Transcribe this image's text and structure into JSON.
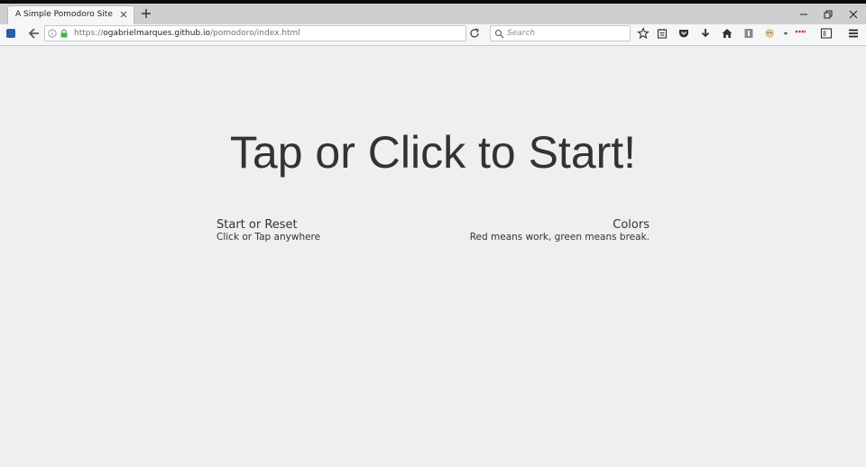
{
  "browser": {
    "tab": {
      "title": "A Simple Pomodoro Site"
    },
    "url": {
      "scheme": "https://",
      "host": "ogabrielmarques.github.io",
      "path": "/pomodoro/index.html"
    },
    "search": {
      "placeholder": "Search"
    },
    "toolbar_icons": [
      "star-icon",
      "reading-list-icon",
      "pocket-icon",
      "download-icon",
      "home-icon",
      "library-icon",
      "extension-icon",
      "overflow-icon",
      "extension-red-icon",
      "sidebar-icon",
      "menu-icon"
    ]
  },
  "page": {
    "heading": "Tap or Click to Start!",
    "left_block": {
      "title": "Start or Reset",
      "subtitle": "Click or Tap anywhere"
    },
    "right_block": {
      "title": "Colors",
      "subtitle": "Red means work, green means break."
    }
  }
}
